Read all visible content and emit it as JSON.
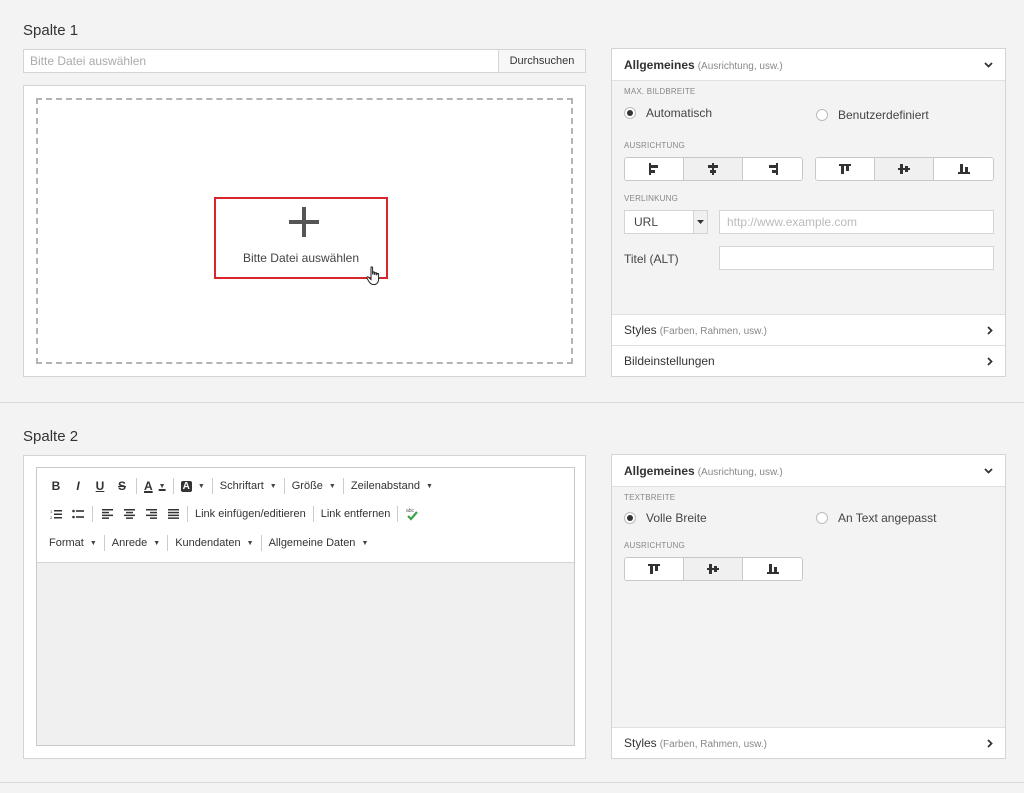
{
  "section1": {
    "title": "Spalte 1",
    "file_placeholder": "Bitte Datei auswählen",
    "browse_label": "Durchsuchen",
    "drop_label": "Bitte Datei auswählen",
    "panel": {
      "header_title": "Allgemeines",
      "header_sub": "(Ausrichtung, usw.)",
      "max_width_label": "MAX. BILDBREITE",
      "radio_auto": "Automatisch",
      "radio_custom": "Benutzerdefiniert",
      "align_label": "AUSRICHTUNG",
      "link_label": "VERLINKUNG",
      "link_type": "URL",
      "link_placeholder": "http://www.example.com",
      "title_alt_label": "Titel (ALT)",
      "styles_title": "Styles",
      "styles_sub": "(Farben, Rahmen, usw.)",
      "image_settings": "Bildeinstellungen"
    }
  },
  "section2": {
    "title": "Spalte 2",
    "toolbar": {
      "bold": "B",
      "italic": "I",
      "underline": "U",
      "strike": "S",
      "font_color": "A",
      "bg_color": "A",
      "font": "Schriftart",
      "size": "Größe",
      "line_height": "Zeilenabstand",
      "insert_link": "Link einfügen/editieren",
      "remove_link": "Link entfernen",
      "format": "Format",
      "salutation": "Anrede",
      "customer_data": "Kundendaten",
      "general_data": "Allgemeine Daten"
    },
    "panel": {
      "header_title": "Allgemeines",
      "header_sub": "(Ausrichtung, usw.)",
      "text_width_label": "TEXTBREITE",
      "radio_full": "Volle Breite",
      "radio_fit": "An Text angepasst",
      "align_label": "AUSRICHTUNG",
      "styles_title": "Styles",
      "styles_sub": "(Farben, Rahmen, usw.)"
    }
  },
  "colors": {
    "highlight": "#d9262b",
    "check": "#3aa34a"
  }
}
